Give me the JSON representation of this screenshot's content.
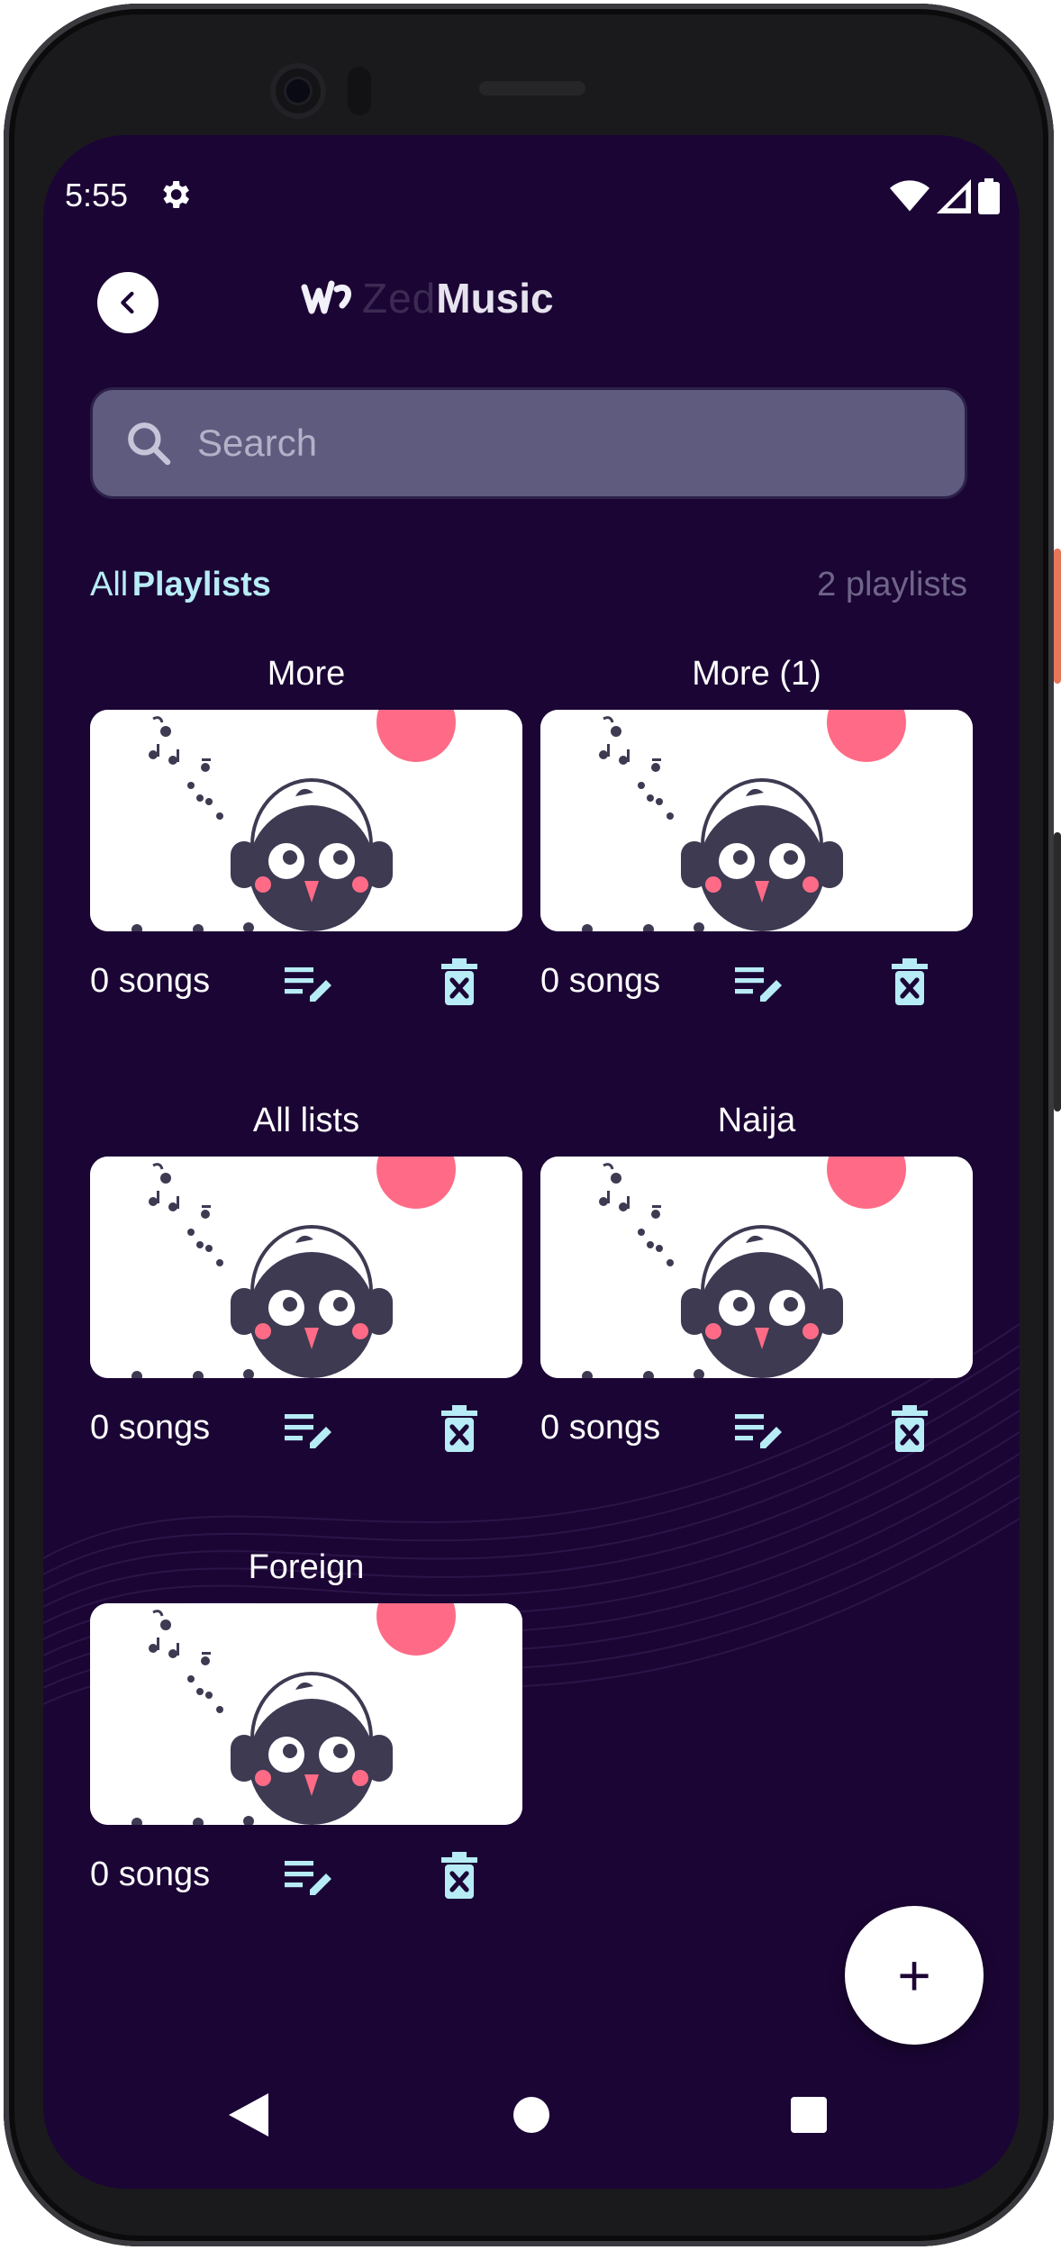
{
  "status_bar": {
    "time": "5:55",
    "icons": [
      "gear-icon",
      "wifi-icon",
      "cell-signal-icon",
      "battery-icon"
    ]
  },
  "header": {
    "back_icon": "chevron-left-icon",
    "logo_zed": "Zed",
    "logo_music": "Music"
  },
  "search": {
    "placeholder": "Search",
    "value": ""
  },
  "section": {
    "all_label": "All",
    "playlists_label": "Playlists",
    "count_text": "2 playlists"
  },
  "playlists": [
    {
      "title": "More",
      "songs": "0 songs"
    },
    {
      "title": "More (1)",
      "songs": "0 songs"
    },
    {
      "title": "All lists",
      "songs": "0 songs"
    },
    {
      "title": "Naija",
      "songs": "0 songs"
    },
    {
      "title": "Foreign",
      "songs": "0 songs"
    }
  ],
  "fab": {
    "icon": "plus-icon",
    "label": "+"
  },
  "colors": {
    "background": "#1b0535",
    "accent": "#b7ecf6",
    "search_bg": "#5e5b7e",
    "art_pink": "#ff6b86",
    "art_dark": "#3d3a52"
  }
}
